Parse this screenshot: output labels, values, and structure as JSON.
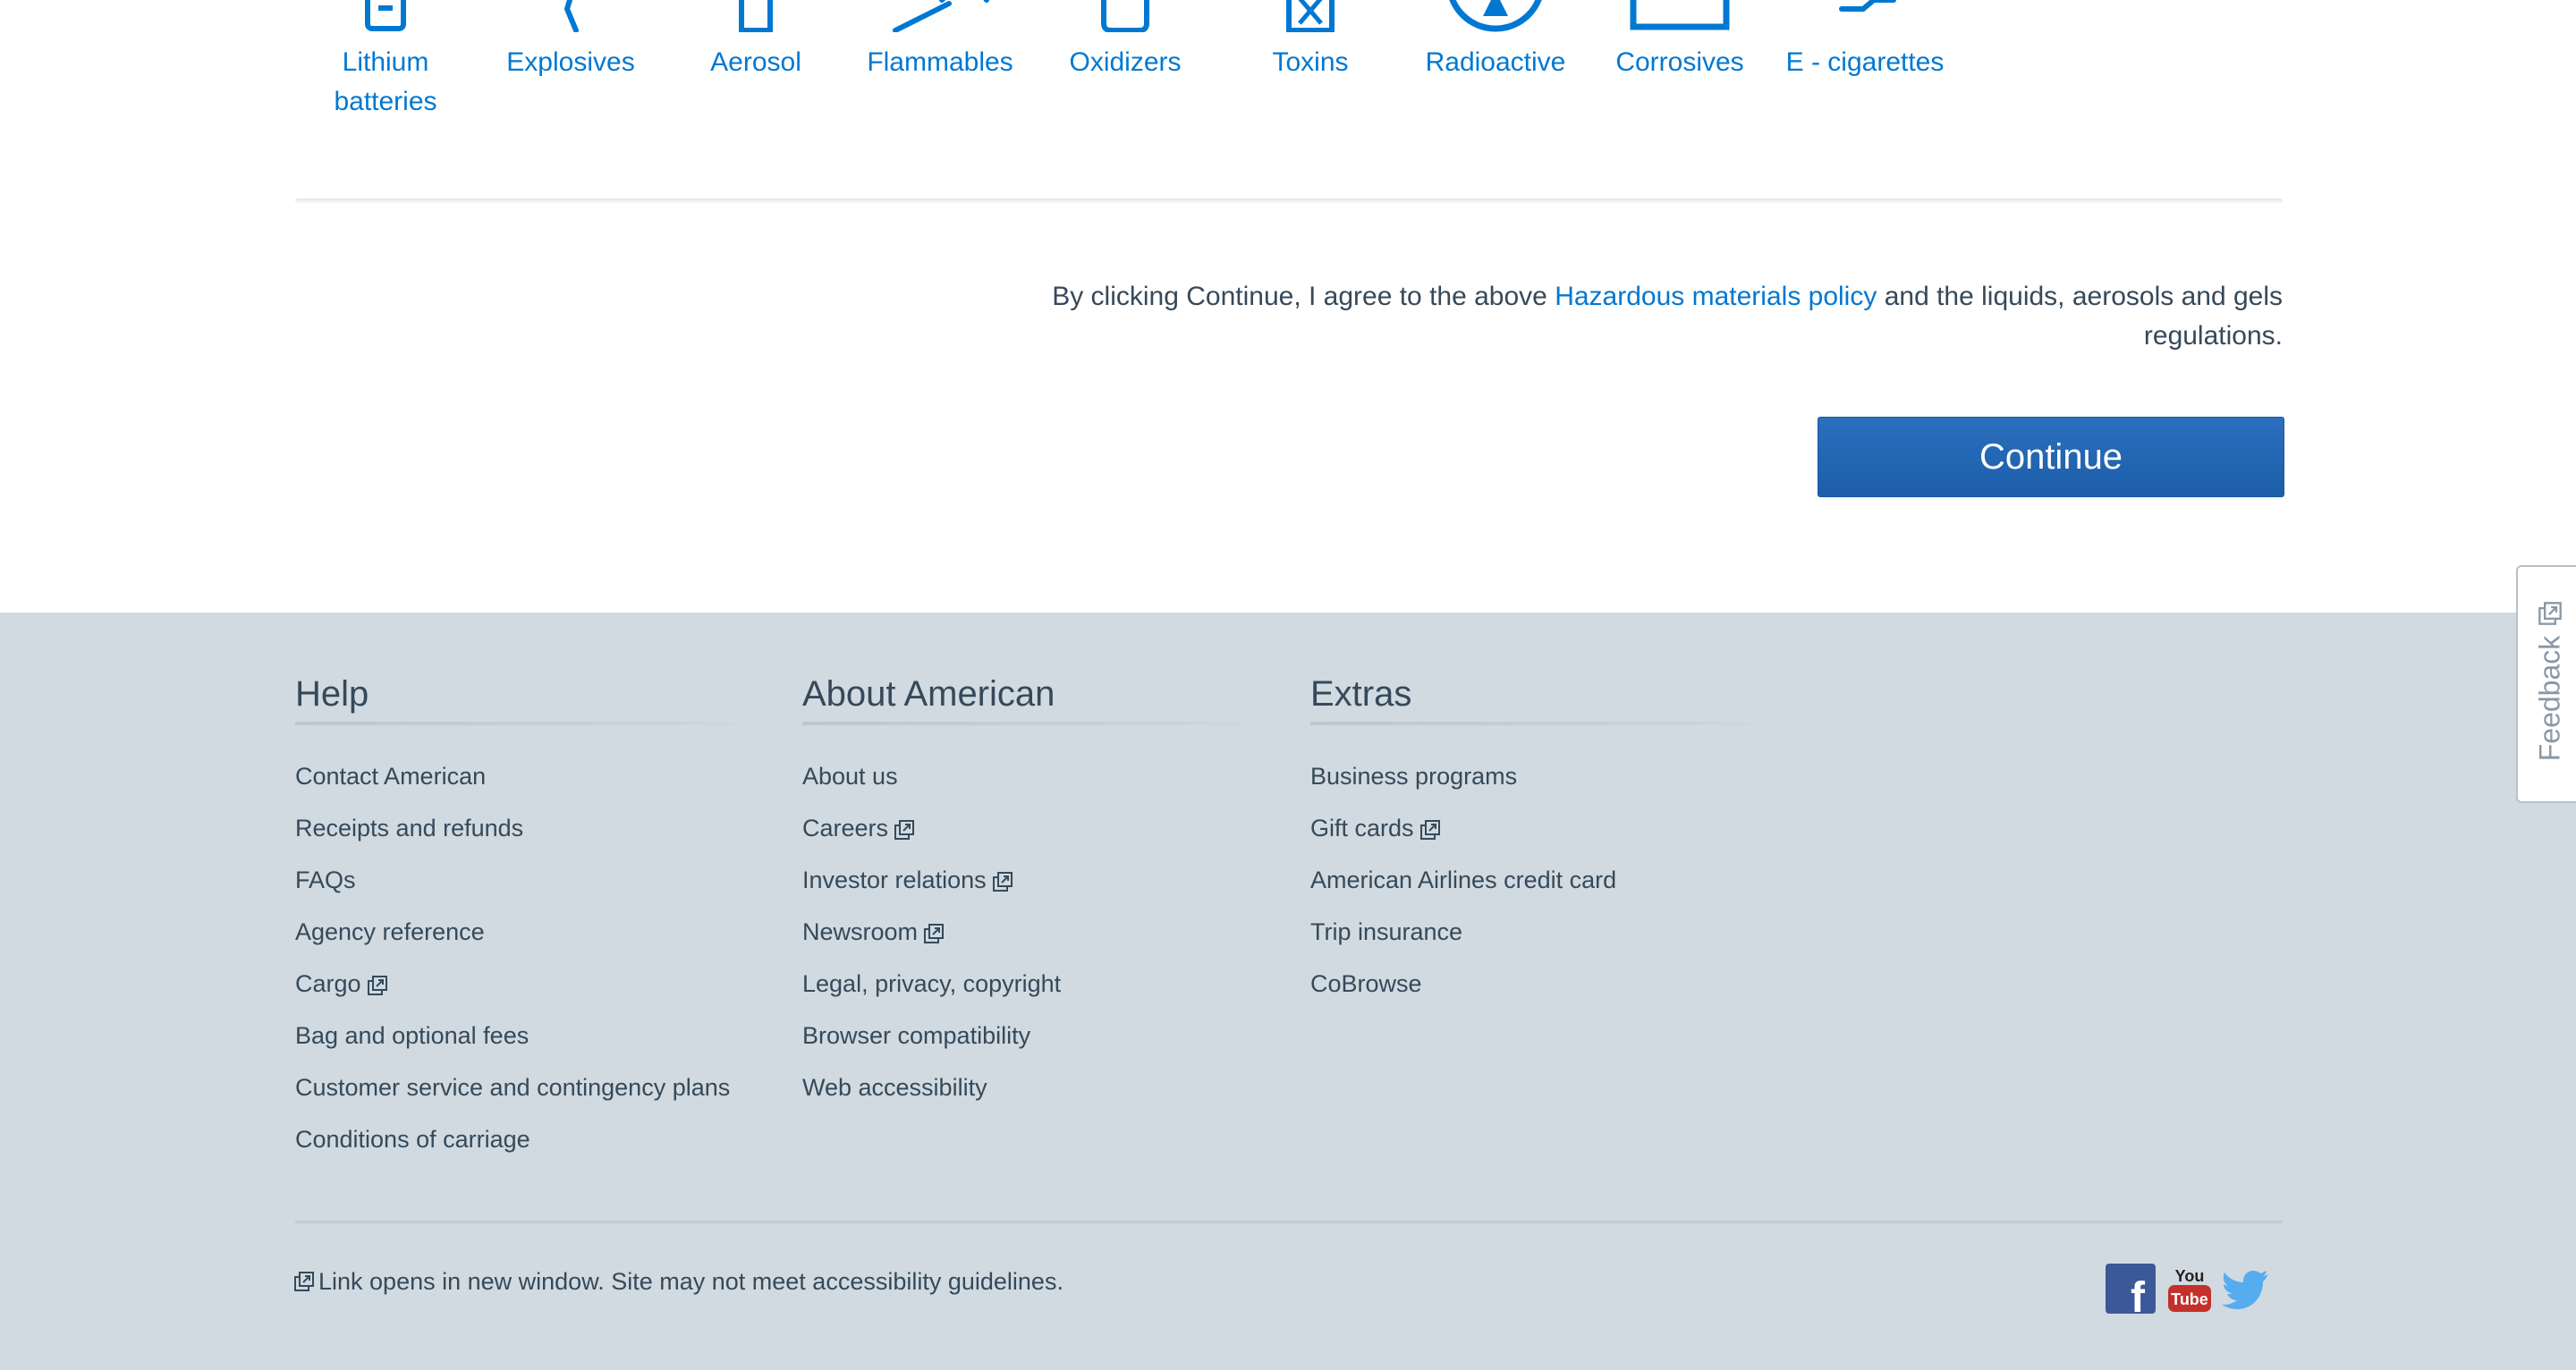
{
  "hazards": [
    {
      "label": "Lithium batteries",
      "icon": "battery-icon"
    },
    {
      "label": "Explosives",
      "icon": "explosive-icon"
    },
    {
      "label": "Aerosol",
      "icon": "aerosol-icon"
    },
    {
      "label": "Flammables",
      "icon": "flammable-icon"
    },
    {
      "label": "Oxidizers",
      "icon": "oxidizer-icon"
    },
    {
      "label": "Toxins",
      "icon": "toxin-icon"
    },
    {
      "label": "Radioactive",
      "icon": "radioactive-icon"
    },
    {
      "label": "Corrosives",
      "icon": "corrosive-icon"
    },
    {
      "label": "E - cigarettes",
      "icon": "e-cigarette-icon"
    }
  ],
  "agreement": {
    "prefix": "By clicking Continue, I agree to the above ",
    "link": "Hazardous materials policy",
    "suffix": " and the liquids, aerosols and gels regulations."
  },
  "continue_label": "Continue",
  "footer": {
    "columns": [
      {
        "title": "Help",
        "links": [
          {
            "label": "Contact American",
            "external": false
          },
          {
            "label": "Receipts and refunds",
            "external": false
          },
          {
            "label": "FAQs",
            "external": false
          },
          {
            "label": "Agency reference",
            "external": false
          },
          {
            "label": "Cargo",
            "external": true
          },
          {
            "label": "Bag and optional fees",
            "external": false
          },
          {
            "label": "Customer service and contingency plans",
            "external": false
          },
          {
            "label": "Conditions of carriage",
            "external": false
          }
        ]
      },
      {
        "title": "About American",
        "links": [
          {
            "label": "About us",
            "external": false
          },
          {
            "label": "Careers",
            "external": true
          },
          {
            "label": "Investor relations",
            "external": true
          },
          {
            "label": "Newsroom",
            "external": true
          },
          {
            "label": "Legal, privacy, copyright",
            "external": false
          },
          {
            "label": "Browser compatibility",
            "external": false
          },
          {
            "label": "Web accessibility",
            "external": false
          }
        ]
      },
      {
        "title": "Extras",
        "links": [
          {
            "label": "Business programs",
            "external": false
          },
          {
            "label": "Gift cards",
            "external": true
          },
          {
            "label": "American Airlines credit card",
            "external": false
          },
          {
            "label": "Trip insurance",
            "external": false
          },
          {
            "label": "CoBrowse",
            "external": false
          }
        ]
      }
    ],
    "note": "Link opens in new window. Site may not meet accessibility guidelines.",
    "social": [
      {
        "logo_text": "f",
        "icon": "facebook-icon",
        "color": "#3b5998"
      },
      {
        "logo_text": "You Tube",
        "icon": "youtube-icon",
        "color": "#c4302b"
      },
      {
        "logo_text": "",
        "icon": "twitter-icon",
        "color": "#55acee"
      }
    ]
  },
  "feedback_label": "Feedback",
  "colors": {
    "link": "#0078d2",
    "button": "#1c5ea8",
    "footer_bg": "#d0dae0",
    "text": "#36495a"
  }
}
